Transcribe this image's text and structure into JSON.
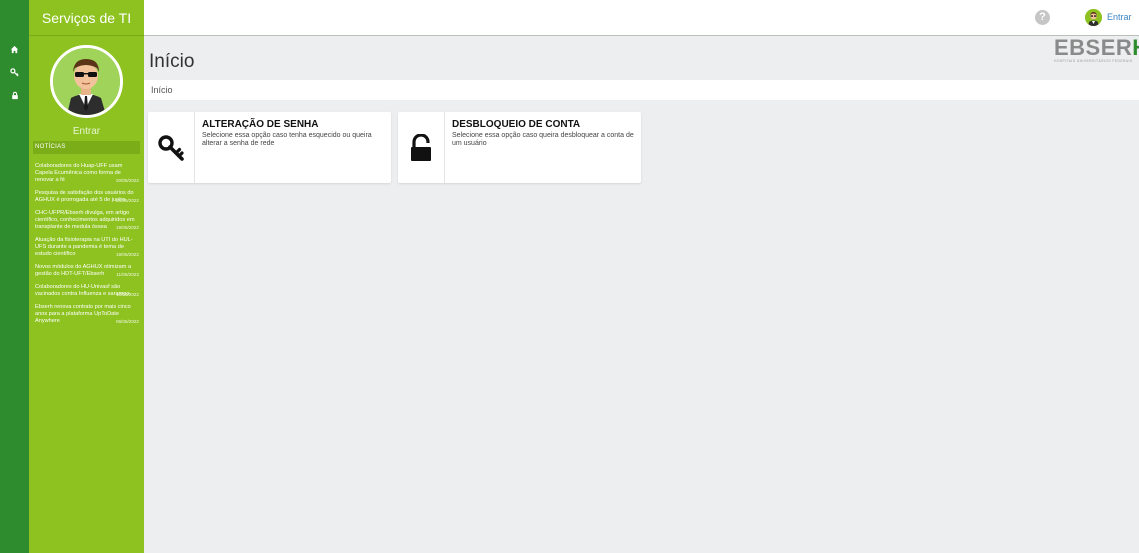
{
  "sidebar": {
    "title": "Serviços de TI",
    "signin_label": "Entrar",
    "news_heading": "NOTÍCIAS",
    "news": [
      {
        "text": "Colaboradores do Huap-UFF usam Capela Ecumênica como forma de renovar a fé",
        "date": "20/05/2022"
      },
      {
        "text": "Pesquisa de satisfação dos usuários do AGHUX é prorrogada até 5 de junho",
        "date": "20/05/2022"
      },
      {
        "text": "CHC-UFPR/Ebserh divulga, em artigo científico, conhecimentos adquiridos em transplante de medula óssea",
        "date": "19/05/2022"
      },
      {
        "text": "Atuação da fisioterapia na UTI do HUL-UFS durante a pandemia é tema de estudo científico",
        "date": "19/05/2022"
      },
      {
        "text": "Novos módulos do AGHUX otimizam a gestão do HDT-UFT/Ebserh",
        "date": "11/05/2022"
      },
      {
        "text": "Colaboradores do HU-Univasf são vacinados contra Influenza e sarampo",
        "date": "10/05/2022"
      },
      {
        "text": "Ebserh renova contrato por mais cinco anos para a plataforma UpToDate Anywhere",
        "date": "06/05/2022"
      }
    ]
  },
  "rail": {
    "icons": [
      "home-icon",
      "key-icon",
      "lock-icon"
    ]
  },
  "topbar": {
    "help": "?",
    "signin_link": "Entrar"
  },
  "main": {
    "title": "Início",
    "breadcrumb": "Início",
    "cards": [
      {
        "title": "ALTERAÇÃO DE SENHA",
        "description": "Selecione essa opção caso tenha esquecido ou queira alterar a senha de rede",
        "icon": "key-icon"
      },
      {
        "title": "DESBLOQUEIO DE CONTA",
        "description": "Selecione essa opção caso queira desbloquear a conta de um usuário",
        "icon": "unlock-icon"
      }
    ]
  },
  "logo": {
    "main_text": "EBSER",
    "accent_text": "H",
    "subtitle": "HOSPITAIS UNIVERSITÁRIOS FEDERAIS"
  },
  "colors": {
    "sidebar": "#8dc220",
    "rail": "#2e8b2e",
    "background": "#eceeef",
    "link": "#3a84c4"
  }
}
